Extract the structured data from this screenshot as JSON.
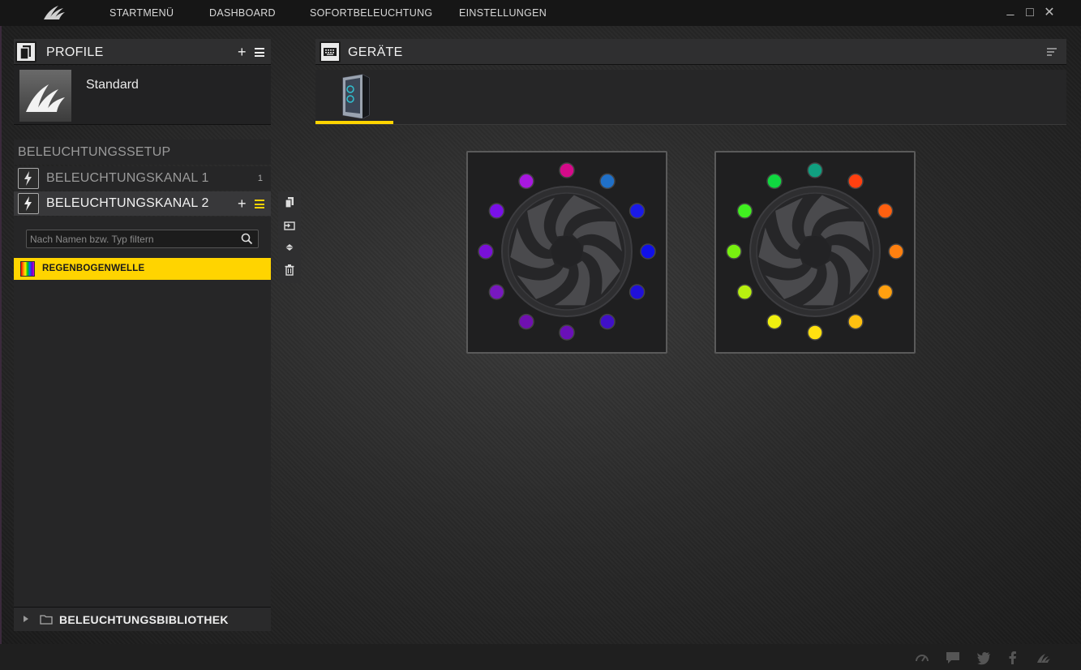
{
  "nav": {
    "items": [
      "STARTMENÜ",
      "DASHBOARD",
      "SOFORTBELEUCHTUNG",
      "EINSTELLUNGEN"
    ]
  },
  "window_controls": {
    "minimize": "_",
    "maximize": "□",
    "close": "✕"
  },
  "profile": {
    "title": "PROFILE",
    "add": "+",
    "name": "Standard"
  },
  "lighting": {
    "setup_title": "BELEUCHTUNGSSETUP",
    "channels": [
      {
        "label": "BELEUCHTUNGSKANAL 1",
        "count": "1"
      },
      {
        "label": "BELEUCHTUNGSKANAL 2",
        "add": "+"
      }
    ],
    "filter_placeholder": "Nach Namen bzw. Typ filtern",
    "effects": [
      {
        "label": "REGENBOGENWELLE"
      }
    ],
    "library_label": "BELEUCHTUNGSBIBLIOTHEK"
  },
  "devices": {
    "title": "GERÄTE"
  },
  "fans": [
    {
      "leds": [
        "#d60a8a",
        "#2070c8",
        "#1a1ae8",
        "#1010e8",
        "#2010d8",
        "#4010c8",
        "#6a10b8",
        "#7010b0",
        "#7818c0",
        "#7a10d8",
        "#7a10e8",
        "#a818e0"
      ]
    },
    {
      "leds": [
        "#10a080",
        "#ff4010",
        "#ff6010",
        "#ff8010",
        "#ffa010",
        "#ffc010",
        "#ffe010",
        "#f0f010",
        "#b8f010",
        "#78f010",
        "#40f020",
        "#10d840"
      ]
    }
  ],
  "colors": {
    "accent": "#ffd400"
  },
  "footer_icons": [
    "speedometer-icon",
    "chat-icon",
    "twitter-icon",
    "facebook-icon",
    "corsair-icon"
  ]
}
